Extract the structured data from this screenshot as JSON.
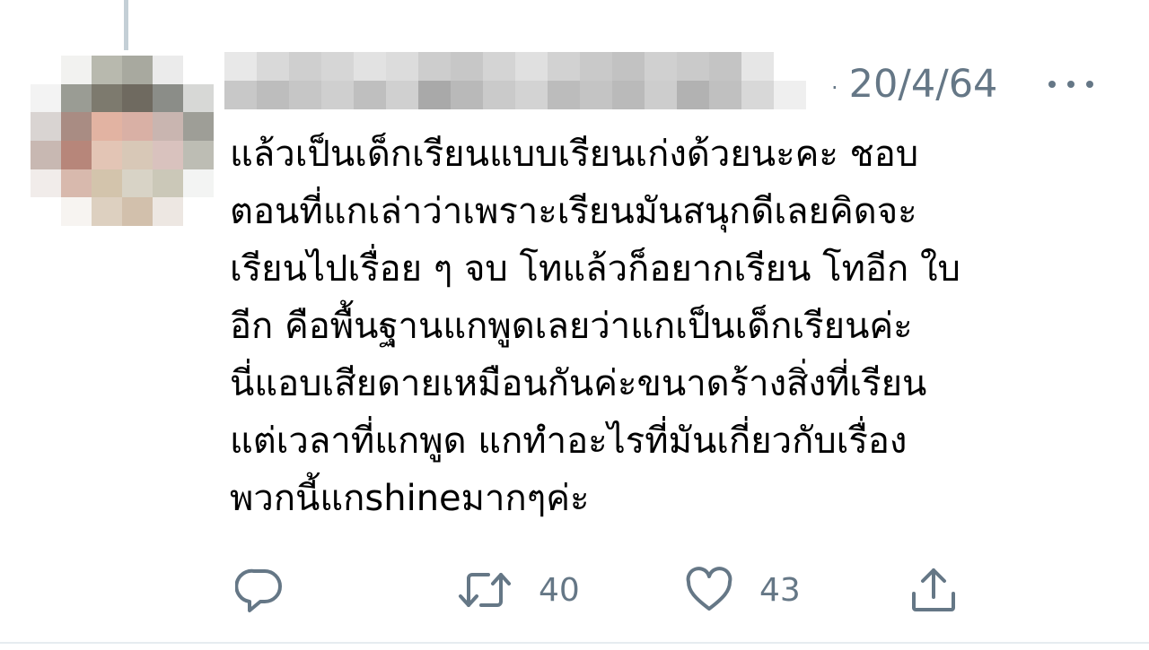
{
  "tweet": {
    "timestamp_separator": "·",
    "timestamp": "20/4/64",
    "body_lines": [
      "แล้วเป็นเด็กเรียนแบบเรียนเก่งด้วยนะคะ ชอบ",
      "ตอนที่แกเล่าว่าเพราะเรียนมันสนุกดีเลยคิดจะ",
      "เรียนไปเรื่อย ๆ จบ โทแล้วก็อยากเรียน โทอีก ใบ",
      "อีก คือพื้นฐานแกพูดเลยว่าแกเป็นเด็กเรียนค่ะ",
      "นี่แอบเสียดายเหมือนกันค่ะขนาดร้างสิ่งที่เรียน",
      "แต่เวลาที่แกพูด  แกทำอะไรที่มันเกี่ยวกับเรื่อง",
      "พวกนี้แกshineมากๆค่ะ"
    ]
  },
  "actions": {
    "reply_icon": "reply-icon",
    "retweet_icon": "retweet-icon",
    "retweet_count": "40",
    "like_icon": "heart-icon",
    "like_count": "43",
    "share_icon": "share-icon"
  },
  "colors": {
    "secondary_text": "#657786",
    "icon": "#657786",
    "thread_line": "#c4cfd6",
    "divider": "#e6ecf0"
  }
}
